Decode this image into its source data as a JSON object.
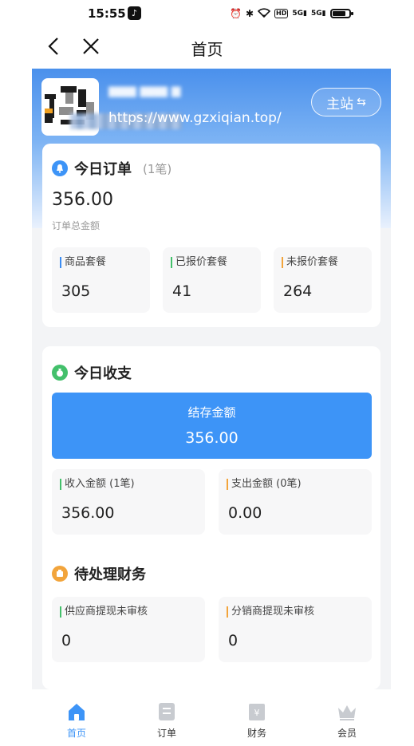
{
  "status_bar": {
    "time": "15:55",
    "hd_label": "HD",
    "signal1": "5G",
    "signal2": "5G"
  },
  "nav": {
    "title": "首页",
    "back_icon": "chevron-left-icon",
    "close_icon": "close-icon"
  },
  "header": {
    "site_url": "https://www.gzxiqian.top/",
    "main_site_button": "主站",
    "switch_icon": "⇆"
  },
  "today_orders": {
    "title": "今日订单",
    "count_label": "(1笔)",
    "total_amount": "356.00",
    "total_label": "订单总金额",
    "stats": [
      {
        "label": "商品套餐",
        "value": "305"
      },
      {
        "label": "已报价套餐",
        "value": "41"
      },
      {
        "label": "未报价套餐",
        "value": "264"
      }
    ]
  },
  "today_finance": {
    "title": "今日收支",
    "balance_label": "结存金额",
    "balance_value": "356.00",
    "income_label": "收入金额 (1笔)",
    "income_value": "356.00",
    "expense_label": "支出金额 (0笔)",
    "expense_value": "0.00"
  },
  "pending_finance": {
    "title": "待处理财务",
    "supplier_label": "供应商提现未审核",
    "supplier_value": "0",
    "distributor_label": "分销商提现未审核",
    "distributor_value": "0"
  },
  "tabs": [
    {
      "label": "首页",
      "icon": "home-icon",
      "active": true
    },
    {
      "label": "订单",
      "icon": "order-icon",
      "active": false
    },
    {
      "label": "财务",
      "icon": "finance-icon",
      "active": false
    },
    {
      "label": "会员",
      "icon": "crown-icon",
      "active": false
    }
  ],
  "colors": {
    "accent": "#3d94f7",
    "green": "#43c06b",
    "orange": "#f2a43b"
  }
}
